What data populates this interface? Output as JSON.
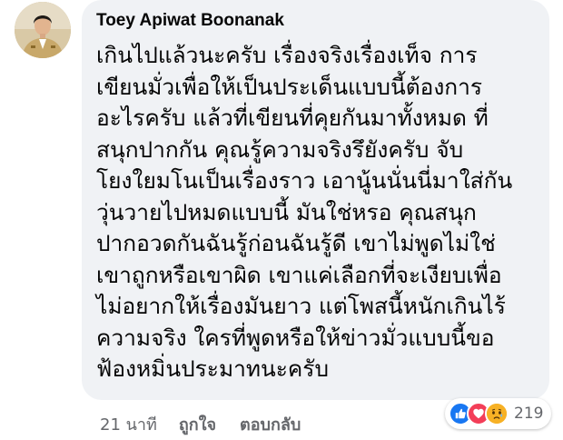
{
  "comment": {
    "author": "Toey Apiwat Boonanak",
    "lines": [
      "เกินไปแล้วนะครับ เรื่องจริงเรื่องเท็จ การ",
      "เขียนมั่วเพื่อให้เป็นประเด็นแบบนี้ต้องการ",
      "อะไรครับ แล้วที่เขียนที่คุยกันมาทั้งหมด ที่",
      "สนุกปากกัน คุณรู้ความจริงรึยังครับ จับ",
      "โยงใยมโนเป็นเรื่องราว เอานู้นนั่นนี่มาใส่กัน",
      "วุ่นวายไปหมดแบบนี้ มันใช่หรอ คุณสนุก",
      "ปากอวดกันฉันรู้ก่อนฉันรู้ดี เขาไม่พูดไม่ใช่",
      "เขาถูกหรือเขาผิด เขาแค่เลือกที่จะเงียบเพื่อ",
      "ไม่อยากให้เรื่องมันยาว แต่โพสนี้หนักเกินไร้",
      "ความจริง ใครที่พูดหรือให้ข่าวมั่วแบบนี้ขอ",
      "ฟ้องหมิ่นประมาทนะครับ"
    ],
    "timestamp": "21 นาที",
    "like_label": "ถูกใจ",
    "reply_label": "ตอบกลับ",
    "reactions": {
      "icons": [
        "like-icon",
        "love-icon",
        "sad-icon"
      ],
      "count": "219",
      "colors": {
        "like": "#1877f2",
        "love": "#f33e58",
        "sad": "#f7b125"
      }
    }
  }
}
